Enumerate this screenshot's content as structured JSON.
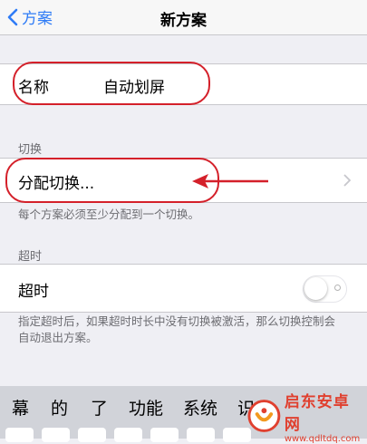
{
  "navbar": {
    "back_label": "方案",
    "title": "新方案"
  },
  "name_cell": {
    "label": "名称",
    "value": "自动划屏"
  },
  "switch_section": {
    "header": "切换",
    "assign_label": "分配切换...",
    "footer": "每个方案必须至少分配到一个切换。"
  },
  "timeout_section": {
    "header": "超时",
    "label": "超时",
    "enabled": false,
    "footer_line1": "指定超时后，如果超时时长中没有切换被激活，那么切换控制会",
    "footer_line2": "自动退出方案。"
  },
  "keyboard": {
    "suggestions": [
      "幕",
      "的",
      "了",
      "功能",
      "系统",
      "识"
    ]
  },
  "watermark": {
    "title": "启东安卓网",
    "url": "www.qdltdq.com"
  },
  "colors": {
    "accent": "#2f7cf6",
    "annotation": "#d4202a",
    "background": "#efeff4"
  }
}
